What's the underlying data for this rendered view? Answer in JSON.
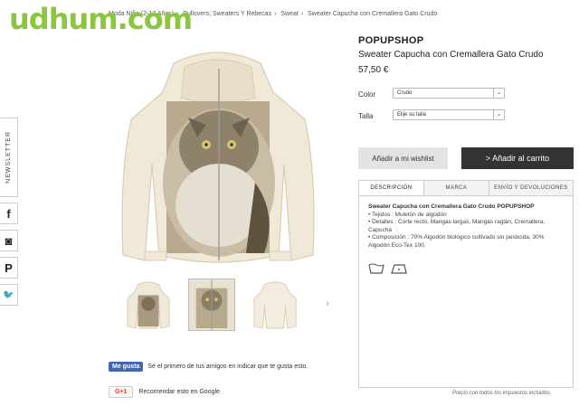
{
  "watermark": "udhum.com",
  "breadcrumb": [
    "Moda Niño (2-12 Años)",
    "Pullovers, Sweaters Y Rebecas",
    "Sweat",
    "Sweater Capucha con Cremallera Gato Crudo"
  ],
  "rail": {
    "newsletter": "NEWSLETTER",
    "facebook": "f",
    "instagram": "◙",
    "pinterest": "P",
    "twitter": "🐦"
  },
  "product": {
    "brand": "POPUPSHOP",
    "name": "Sweater Capucha con Cremallera Gato Crudo",
    "price": "57,50 €",
    "color_label": "Color",
    "color_value": "Crudo",
    "size_label": "Talla",
    "size_value": "Elije su talla",
    "wishlist": "Añadir a mi wishlist",
    "cart": "> Añadir al carrito"
  },
  "tabs": [
    "DESCRIPCIÓN",
    "MARCA",
    "ENVÍO Y DEVOLUCIONES"
  ],
  "description": {
    "title": "Sweater Capucha con Cremallera Gato Crudo POPUPSHOP",
    "lines": [
      "• Tejidos : Muletón de algodón",
      "• Detalles : Corte recto, Mangas largas, Mangas raglán, Cremallera, Capucha",
      "• Composición : 70% Algodón biológico cultivado sin pesticida, 30% Algodón Eco-Tex 100."
    ]
  },
  "tax_note": "Precio con todos los impuestos incluidos.",
  "social": {
    "fb_button": "Me gusta",
    "fb_text": "Sé el primero de tus amigos en indicar que te gusta esto.",
    "gp_button": "G+1",
    "gp_text": "Recomendar esto en Google"
  },
  "colors": {
    "cart_bg": "#333333",
    "wishlist_bg": "#e3e3e3",
    "watermark": "#8cc63f",
    "facebook": "#4267b2"
  }
}
